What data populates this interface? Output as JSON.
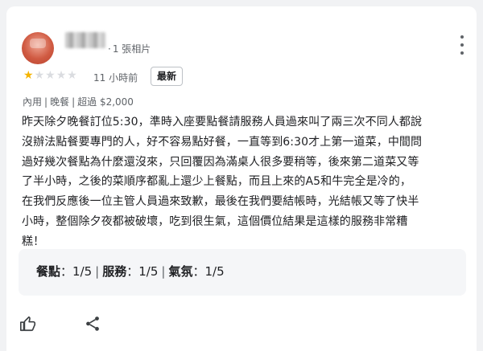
{
  "review": {
    "photo_count": "1 張相片",
    "rating_stars": 1,
    "rating_max": 5,
    "time_ago": "11 小時前",
    "badge": "最新",
    "meta": [
      "內用",
      "晚餐",
      "超過 $2,000"
    ],
    "text": "昨天除夕晚餐訂位5:30，準時入座要點餐請服務人員過來叫了兩三次不同人都說\n沒辦法點餐要專門的人，好不容易點好餐，一直等到6:30才上第一道菜，中間問\n過好幾次餐點為什麼還沒來，只回覆因為滿桌人很多要稍等，後來第二道菜又等\n了半小時，之後的菜順序都亂上還少上餐點，而且上來的A5和牛完全是冷的，\n在我們反應後一位主管人員過來致歉，最後在我們要結帳時，光結帳又等了快半\n小時，整個除夕夜都被破壞，吃到很生氣，這個價位結果是這樣的服務非常糟\n糕！",
    "scores": [
      {
        "label": "餐點",
        "value": "1/5"
      },
      {
        "label": "服務",
        "value": "1/5"
      },
      {
        "label": "氣氛",
        "value": "1/5"
      }
    ]
  },
  "icons": {
    "more": "more-vertical-icon",
    "like": "thumbs-up-icon",
    "share": "share-icon"
  },
  "colors": {
    "star_on": "#f5b400",
    "star_off": "#dadce0",
    "muted_text": "#5f6368"
  }
}
